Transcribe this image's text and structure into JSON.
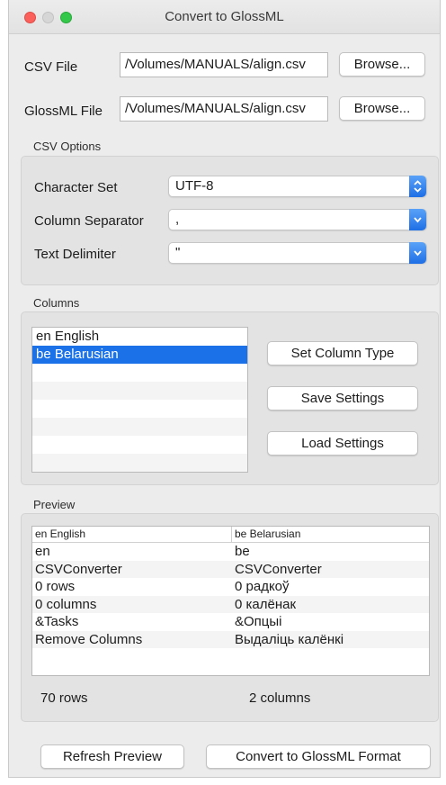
{
  "window": {
    "title": "Convert to GlossML"
  },
  "files": {
    "csv_label": "CSV File",
    "csv_path": "/Volumes/MANUALS/align.csv",
    "glossml_label": "GlossML File",
    "glossml_path": "/Volumes/MANUALS/align.csv",
    "browse_label": "Browse..."
  },
  "csv_options": {
    "section_title": "CSV Options",
    "charset_label": "Character Set",
    "charset_value": "UTF-8",
    "separator_label": "Column Separator",
    "separator_value": ",",
    "delimiter_label": "Text Delimiter",
    "delimiter_value": "\""
  },
  "columns": {
    "section_title": "Columns",
    "items": [
      "en English",
      "be Belarusian"
    ],
    "selected_index": 1,
    "set_type_label": "Set Column Type",
    "save_label": "Save Settings",
    "load_label": "Load Settings"
  },
  "preview": {
    "section_title": "Preview",
    "headers": [
      "en English",
      "be Belarusian"
    ],
    "rows": [
      [
        "en",
        "be"
      ],
      [
        "CSVConverter",
        "CSVConverter"
      ],
      [
        "0 rows",
        "0 радкоў"
      ],
      [
        "0 columns",
        "0 калёнак"
      ],
      [
        "&Tasks",
        "&Опцыі"
      ],
      [
        "Remove Columns",
        "Выдаліць калёнкі"
      ]
    ],
    "row_count": "70 rows",
    "column_count": "2 columns"
  },
  "actions": {
    "refresh_label": "Refresh Preview",
    "convert_label": "Convert to GlossML Format"
  },
  "colors": {
    "accent": "#1b72e8",
    "close": "#fc605b",
    "zoom": "#34c84a"
  }
}
